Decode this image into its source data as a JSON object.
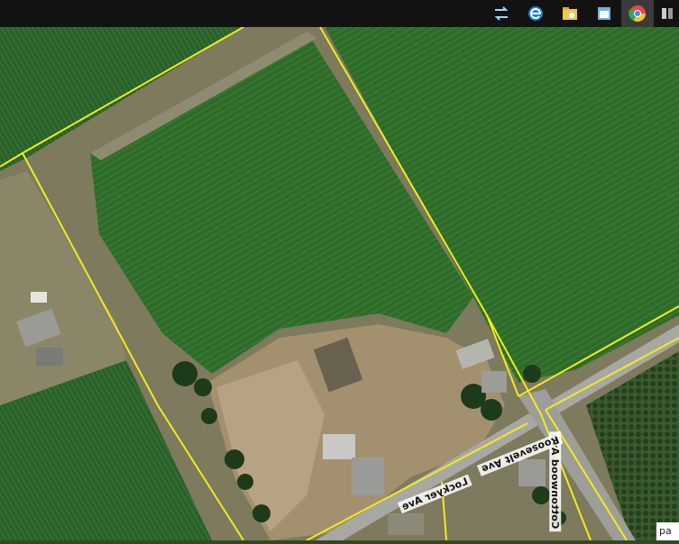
{
  "taskbar": {
    "icons": [
      {
        "name": "sync-app-icon",
        "glyph": "⇌"
      },
      {
        "name": "edge-browser-icon",
        "glyph": "e"
      },
      {
        "name": "folder-icon",
        "glyph": ""
      },
      {
        "name": "notepad-icon",
        "glyph": ""
      },
      {
        "name": "chrome-browser-icon",
        "glyph": ""
      },
      {
        "name": "app-icon",
        "glyph": ""
      }
    ]
  },
  "map": {
    "roads": {
      "cottonwood": "Cottonwood Ave",
      "lockyer": "Lockyer Ave",
      "roosevelt": "Roosevelt Ave"
    },
    "corner_text": "pa"
  },
  "colors": {
    "field_green": "#2f6a2c",
    "field_dark": "#27552a",
    "dirt": "#b09c7c",
    "road": "#a8a8a0",
    "parcel_line": "#f2ea1e"
  }
}
